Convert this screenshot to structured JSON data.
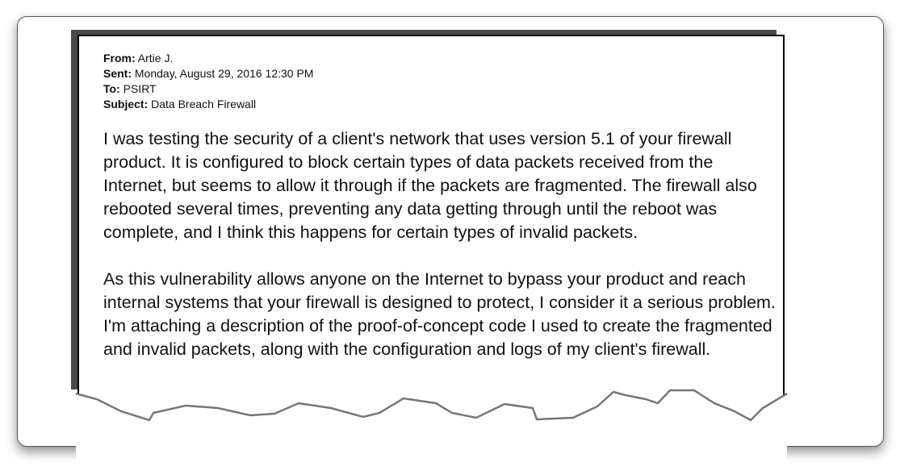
{
  "email": {
    "from_label": "From:",
    "from_value": "Artie J.",
    "sent_label": "Sent:",
    "sent_value": "Monday, August 29, 2016 12:30 PM",
    "to_label": "To:",
    "to_value": "PSIRT",
    "subject_label": "Subject:",
    "subject_value": "Data Breach Firewall",
    "paragraphs": [
      "I was testing the security of a client's network that uses version 5.1 of your firewall product. It is configured to block certain types of data packets received from the Internet, but seems to allow it through if the packets are fragmented. The firewall also rebooted several times, preventing any data getting through until the reboot was complete, and I think this happens for certain types of invalid packets.",
      "As this vulnerability allows anyone on the Internet to bypass your product and reach internal systems that your firewall is designed to protect, I consider it a serious problem. I'm attaching a description of the proof-of-concept code I used to create the fragmented and invalid packets, along with the configuration and logs of my client's firewall."
    ]
  }
}
